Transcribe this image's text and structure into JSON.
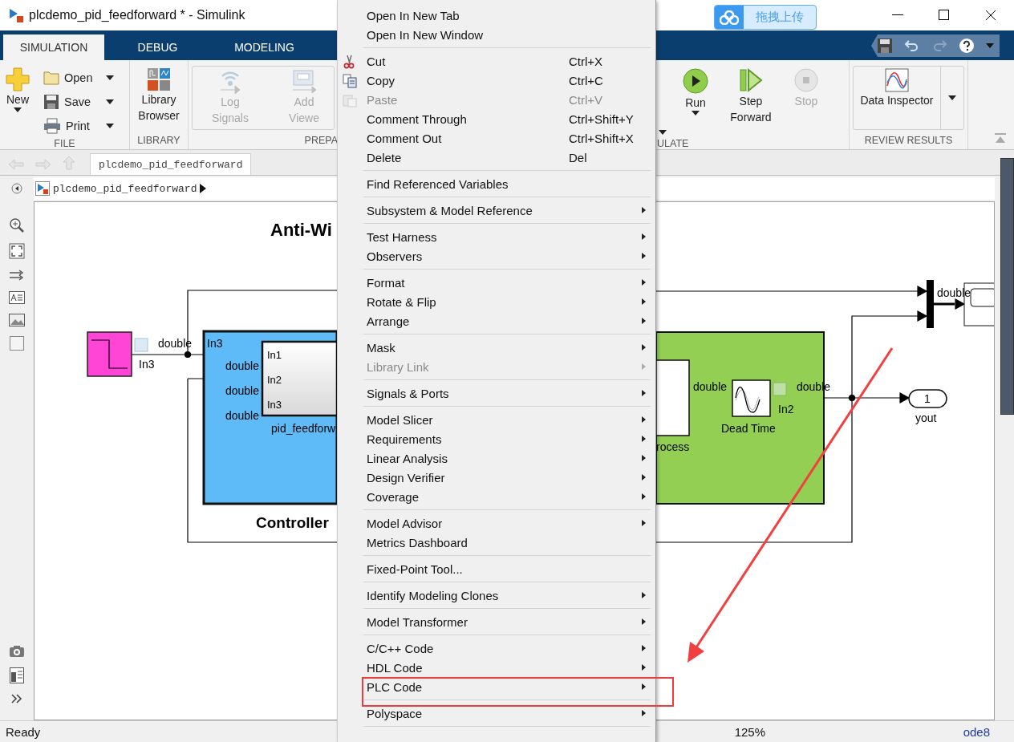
{
  "window": {
    "title": "plcdemo_pid_feedforward * - Simulink"
  },
  "upload_button": {
    "label": "拖拽上传"
  },
  "ribbon_tabs": [
    {
      "label": "SIMULATION",
      "selected": true
    },
    {
      "label": "DEBUG",
      "selected": false
    },
    {
      "label": "MODELING",
      "selected": false
    }
  ],
  "ribbon": {
    "file": {
      "label": "FILE",
      "new": "New",
      "open": "Open",
      "save": "Save",
      "print": "Print"
    },
    "library": {
      "label": "LIBRARY",
      "button": "Library Browser"
    },
    "prepare": {
      "label": "PREPA",
      "buttons": [
        {
          "label": "Log Signals",
          "disabled": true
        },
        {
          "label": "Add Viewe",
          "disabled": true
        }
      ]
    },
    "simulate": {
      "label": "ULATE",
      "buttons": [
        {
          "label": "Run",
          "disabled": false
        },
        {
          "label": "Step Forward",
          "disabled": false
        },
        {
          "label": "Stop",
          "disabled": true
        }
      ]
    },
    "review": {
      "label": "REVIEW RESULTS",
      "button": "Data Inspector"
    }
  },
  "breadcrumb": {
    "tab": "plcdemo_pid_feedforward",
    "path": "plcdemo_pid_feedforward"
  },
  "diagram": {
    "title": "Anti-Wi",
    "step_signal": "double",
    "step_port": "In3",
    "controller_port": "In3",
    "controller_signals": [
      "double",
      "double",
      "double"
    ],
    "inner_ports": [
      "In1",
      "In2",
      "In3"
    ],
    "inner_name": "pid_feedforw",
    "controller_name": "Controller",
    "process_name": "rocess",
    "process_signal": "double",
    "dead_time_name": "Dead Time",
    "dead_time_port": "In2",
    "dead_time_signal": "double",
    "outport_number": "1",
    "outport_name": "yout",
    "mux_signal": "double"
  },
  "context_menu": {
    "items": [
      {
        "kind": "item",
        "label": "Open In New Tab",
        "submenu": false,
        "disabled": false
      },
      {
        "kind": "item",
        "label": "Open In New Window",
        "submenu": false,
        "disabled": false
      },
      {
        "kind": "separator"
      },
      {
        "kind": "icon-item",
        "label": "Cut",
        "shortcut": "Ctrl+X",
        "submenu": false,
        "disabled": false
      },
      {
        "kind": "icon-item",
        "label": "Copy",
        "shortcut": "Ctrl+C",
        "submenu": false,
        "disabled": false
      },
      {
        "kind": "icon-item",
        "label": "Paste",
        "shortcut": "Ctrl+V",
        "submenu": false,
        "disabled": true
      },
      {
        "kind": "item",
        "label": "Comment Through",
        "shortcut": "Ctrl+Shift+Y",
        "submenu": false,
        "disabled": false
      },
      {
        "kind": "item",
        "label": "Comment Out",
        "shortcut": "Ctrl+Shift+X",
        "submenu": false,
        "disabled": false
      },
      {
        "kind": "item",
        "label": "Delete",
        "shortcut": "Del",
        "submenu": false,
        "disabled": false
      },
      {
        "kind": "separator"
      },
      {
        "kind": "item",
        "label": "Find Referenced Variables",
        "submenu": false,
        "disabled": false
      },
      {
        "kind": "separator"
      },
      {
        "kind": "item",
        "label": "Subsystem & Model Reference",
        "submenu": true,
        "disabled": false
      },
      {
        "kind": "separator"
      },
      {
        "kind": "item",
        "label": "Test Harness",
        "submenu": true,
        "disabled": false
      },
      {
        "kind": "item",
        "label": "Observers",
        "submenu": true,
        "disabled": false
      },
      {
        "kind": "separator"
      },
      {
        "kind": "item",
        "label": "Format",
        "submenu": true,
        "disabled": false
      },
      {
        "kind": "item",
        "label": "Rotate & Flip",
        "submenu": true,
        "disabled": false
      },
      {
        "kind": "item",
        "label": "Arrange",
        "submenu": true,
        "disabled": false
      },
      {
        "kind": "separator"
      },
      {
        "kind": "item",
        "label": "Mask",
        "submenu": true,
        "disabled": false
      },
      {
        "kind": "item",
        "label": "Library Link",
        "submenu": true,
        "disabled": true
      },
      {
        "kind": "separator"
      },
      {
        "kind": "item",
        "label": "Signals & Ports",
        "submenu": true,
        "disabled": false
      },
      {
        "kind": "separator"
      },
      {
        "kind": "item",
        "label": "Model Slicer",
        "submenu": true,
        "disabled": false
      },
      {
        "kind": "item",
        "label": "Requirements",
        "submenu": true,
        "disabled": false
      },
      {
        "kind": "item",
        "label": "Linear Analysis",
        "submenu": true,
        "disabled": false
      },
      {
        "kind": "item",
        "label": "Design Verifier",
        "submenu": true,
        "disabled": false
      },
      {
        "kind": "item",
        "label": "Coverage",
        "submenu": true,
        "disabled": false
      },
      {
        "kind": "separator"
      },
      {
        "kind": "item",
        "label": "Model Advisor",
        "submenu": true,
        "disabled": false
      },
      {
        "kind": "item",
        "label": "Metrics Dashboard",
        "submenu": false,
        "disabled": false
      },
      {
        "kind": "separator"
      },
      {
        "kind": "item",
        "label": "Fixed-Point Tool...",
        "submenu": false,
        "disabled": false
      },
      {
        "kind": "separator"
      },
      {
        "kind": "item",
        "label": "Identify Modeling Clones",
        "submenu": true,
        "disabled": false
      },
      {
        "kind": "separator"
      },
      {
        "kind": "item",
        "label": "Model Transformer",
        "submenu": true,
        "disabled": false
      },
      {
        "kind": "separator"
      },
      {
        "kind": "item",
        "label": "C/C++ Code",
        "submenu": true,
        "disabled": false
      },
      {
        "kind": "item",
        "label": "HDL Code",
        "submenu": true,
        "disabled": false
      },
      {
        "kind": "item",
        "label": "PLC Code",
        "submenu": true,
        "disabled": false
      },
      {
        "kind": "separator"
      },
      {
        "kind": "item",
        "label": "Polyspace",
        "submenu": true,
        "disabled": false
      },
      {
        "kind": "separator"
      }
    ]
  },
  "status_bar": {
    "status": "Ready",
    "zoom": "125%",
    "solver": "ode8"
  }
}
